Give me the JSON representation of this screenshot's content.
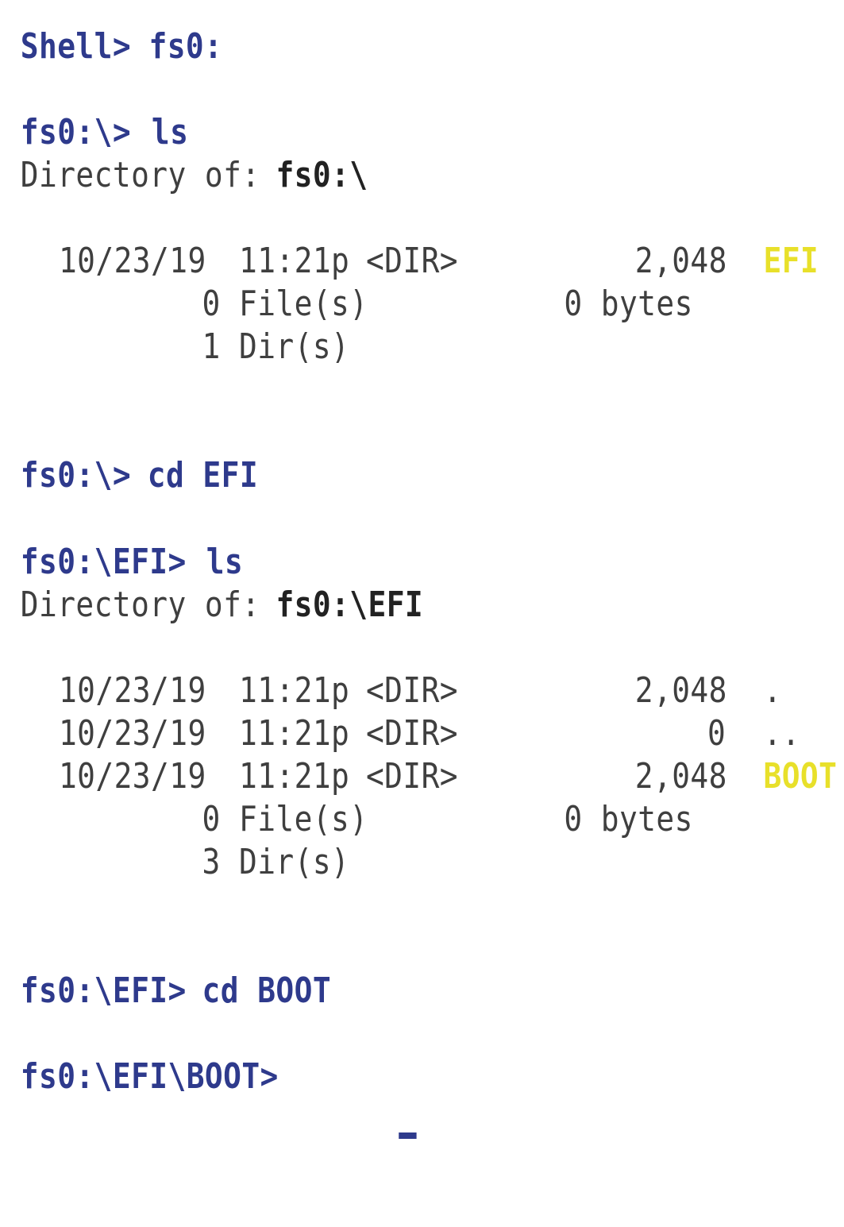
{
  "colors": {
    "background": "#ffffff",
    "prompt": "#2e3a8c",
    "output": "#3f3f3f",
    "highlight_dir": "#e8e02a"
  },
  "blocks": [
    {
      "prompt": "Shell>",
      "command": "fs0:"
    },
    {
      "prompt": "fs0:\\>",
      "command": "ls"
    },
    {
      "dir_label": "Directory of:",
      "dir_path": "fs0:\\"
    },
    {
      "entries": [
        {
          "date": "10/23/19",
          "time": "11:21p",
          "type": "<DIR>",
          "size": "2,048",
          "name": "EFI"
        }
      ]
    },
    {
      "summary": {
        "files_count": "0",
        "files_label": "File(s)",
        "bytes_value": "0",
        "bytes_label": "bytes",
        "dirs_count": "1",
        "dirs_label": "Dir(s)"
      }
    },
    {
      "prompt": "fs0:\\>",
      "command": "cd EFI"
    },
    {
      "prompt": "fs0:\\EFI>",
      "command": "ls"
    },
    {
      "dir_label": "Directory of:",
      "dir_path": "fs0:\\EFI"
    },
    {
      "entries": [
        {
          "date": "10/23/19",
          "time": "11:21p",
          "type": "<DIR>",
          "size": "2,048",
          "name": "."
        },
        {
          "date": "10/23/19",
          "time": "11:21p",
          "type": "<DIR>",
          "size": "0",
          "name": ".."
        },
        {
          "date": "10/23/19",
          "time": "11:21p",
          "type": "<DIR>",
          "size": "2,048",
          "name": "BOOT"
        }
      ]
    },
    {
      "summary": {
        "files_count": "0",
        "files_label": "File(s)",
        "bytes_value": "0",
        "bytes_label": "bytes",
        "dirs_count": "3",
        "dirs_label": "Dir(s)"
      }
    },
    {
      "prompt": "fs0:\\EFI>",
      "command": "cd BOOT"
    },
    {
      "prompt": "fs0:\\EFI\\BOOT>",
      "command": ""
    }
  ]
}
